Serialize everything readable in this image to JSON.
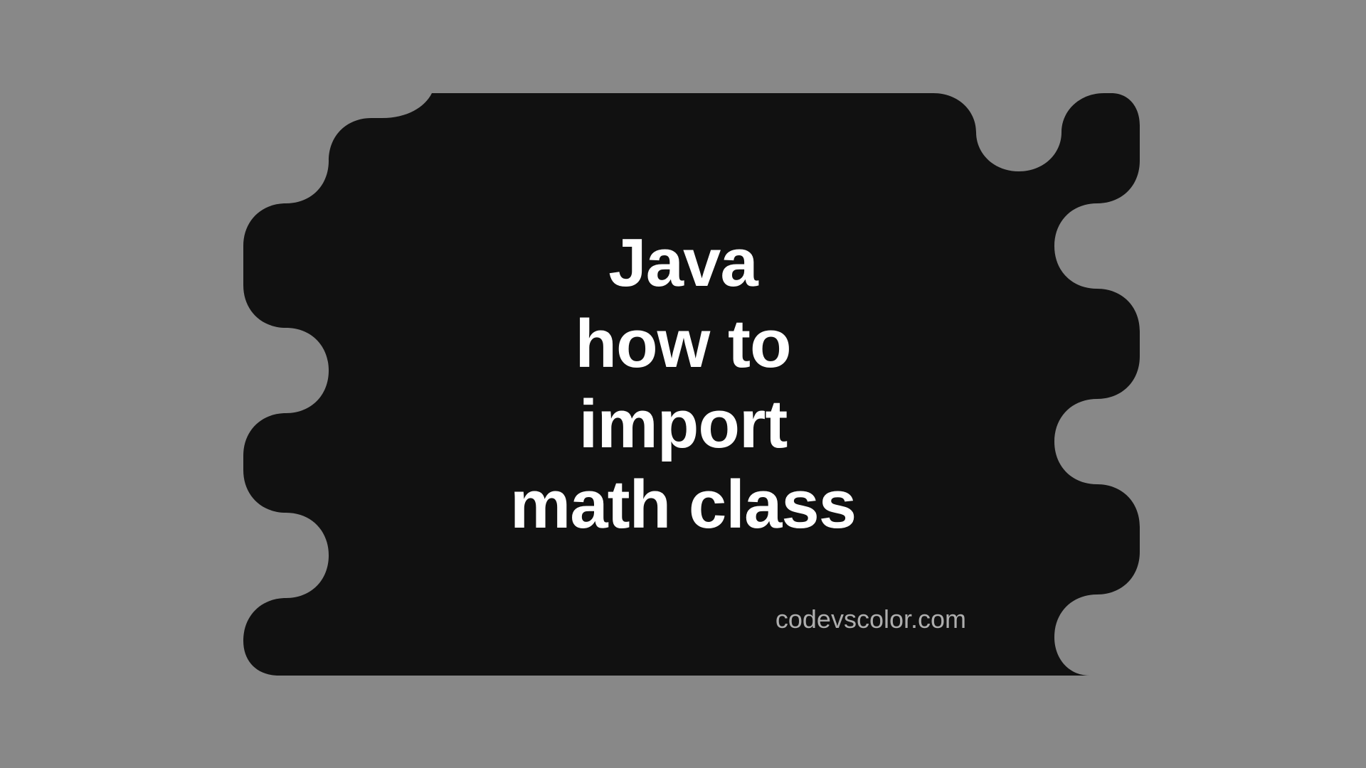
{
  "title": {
    "line1": "Java",
    "line2": "how to",
    "line3": "import",
    "line4": "math class"
  },
  "watermark": "codevscolor.com",
  "colors": {
    "background": "#888888",
    "shape": "#111111",
    "text": "#ffffff",
    "watermark": "#aeaeae"
  }
}
